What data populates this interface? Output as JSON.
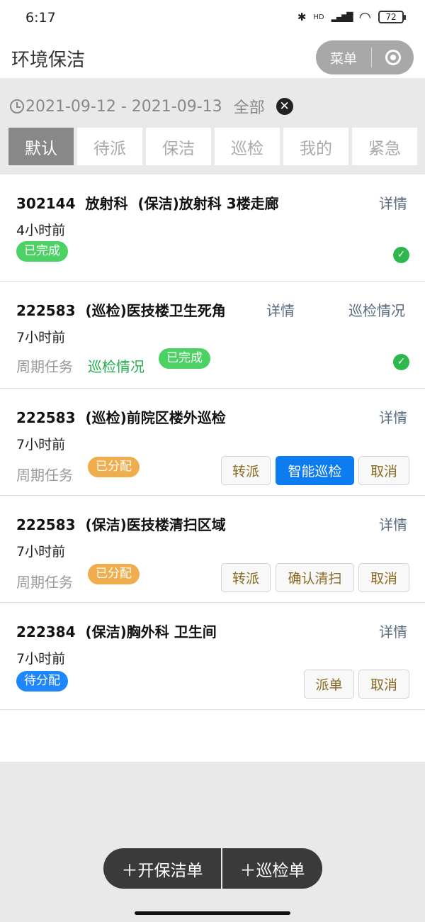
{
  "status": {
    "time": "6:17",
    "battery": "72",
    "hd": "HD",
    "bluetooth": "✱",
    "signal": "▂▄▆█",
    "wifi": "◠"
  },
  "app": {
    "title": "环境保洁",
    "menu_label": "菜单"
  },
  "filter": {
    "date_range": "2021-09-12 - 2021-09-13",
    "all_label": "全部",
    "clear_icon": "✕"
  },
  "tabs": [
    {
      "label": "默认"
    },
    {
      "label": "待派"
    },
    {
      "label": "保洁"
    },
    {
      "label": "巡检"
    },
    {
      "label": "我的"
    },
    {
      "label": "紧急"
    }
  ],
  "orders": [
    {
      "id": "302144",
      "dept": "放射科",
      "desc": "(保洁)放射科 3楼走廊",
      "time_ago": "4小时前",
      "detail": "详情",
      "status": "已完成",
      "check": "✓"
    },
    {
      "id": "222583",
      "desc": "(巡检)医技楼卫生死角",
      "time_ago": "7小时前",
      "detail": "详情",
      "patrol_status": "巡检情况",
      "cycle": "周期任务",
      "status": "已完成",
      "check": "✓"
    },
    {
      "id": "222583",
      "desc": "(巡检)前院区楼外巡检",
      "time_ago": "7小时前",
      "detail": "详情",
      "cycle": "周期任务",
      "status": "已分配",
      "actions": [
        "转派",
        "智能巡检",
        "取消"
      ]
    },
    {
      "id": "222583",
      "desc": "(保洁)医技楼清扫区域",
      "time_ago": "7小时前",
      "detail": "详情",
      "cycle": "周期任务",
      "status": "已分配",
      "actions": [
        "转派",
        "确认清扫",
        "取消"
      ]
    },
    {
      "id": "222384",
      "desc": "(保洁)胸外科 卫生间",
      "time_ago": "7小时前",
      "detail": "详情",
      "status": "待分配",
      "actions": [
        "派单",
        "取消"
      ]
    }
  ],
  "bottom": {
    "new_cleaning": "＋开保洁单",
    "new_patrol": "＋巡检单"
  }
}
